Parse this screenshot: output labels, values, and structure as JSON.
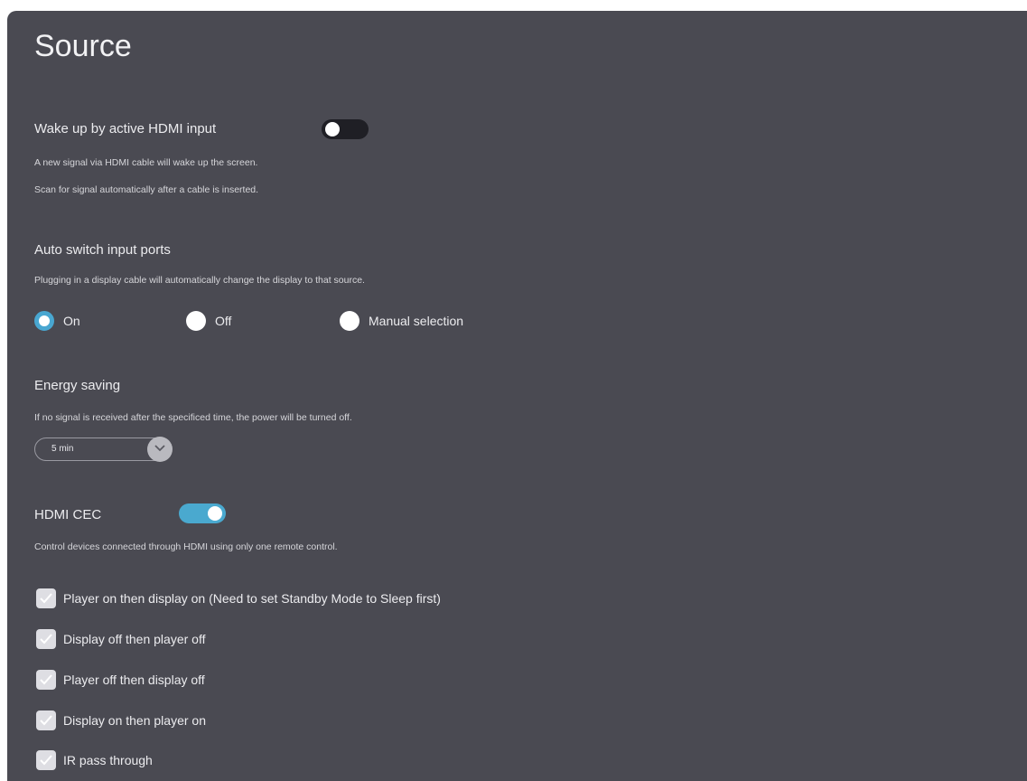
{
  "page": {
    "title": "Source"
  },
  "wake_up": {
    "label": "Wake up by active HDMI input",
    "toggle_state": "off",
    "desc1": "A new signal via HDMI cable will wake up the screen.",
    "desc2": "Scan for signal automatically after a cable is inserted."
  },
  "auto_switch": {
    "label": "Auto switch input ports",
    "desc": "Plugging in a display cable will automatically change the display to that source.",
    "options": [
      {
        "label": "On",
        "selected": true
      },
      {
        "label": "Off",
        "selected": false
      },
      {
        "label": "Manual selection",
        "selected": false
      }
    ]
  },
  "energy": {
    "label": "Energy saving",
    "desc": "If no signal is received after the specificed time, the power will be turned off.",
    "selected_value": "5 min"
  },
  "cec": {
    "label": "HDMI CEC",
    "toggle_state": "on",
    "desc": "Control devices connected through HDMI using only one remote control.",
    "options": [
      {
        "label": "Player on then display on (Need to set Standby Mode to Sleep first)",
        "checked": true
      },
      {
        "label": "Display off then player off",
        "checked": true
      },
      {
        "label": "Player off then display off",
        "checked": true
      },
      {
        "label": "Display on then player on",
        "checked": true
      },
      {
        "label": "IR pass through",
        "checked": true
      }
    ]
  },
  "colors": {
    "panel": "#4a4a52",
    "accent": "#4aa9cf",
    "toggle_off_track": "#1f1f25"
  },
  "icons": {
    "select": "chevron-down-icon",
    "checkbox": "check-icon"
  }
}
